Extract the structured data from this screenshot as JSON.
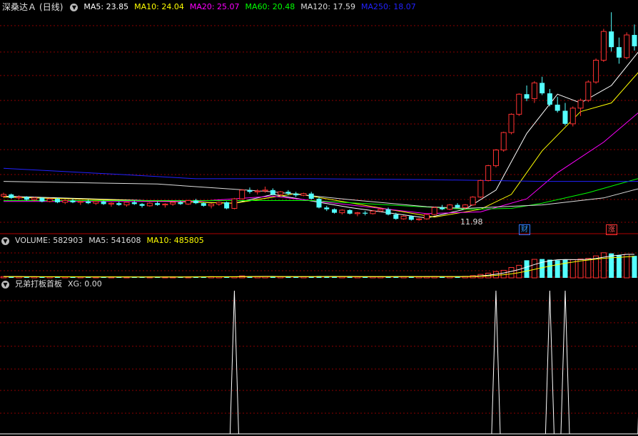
{
  "stock": {
    "name": "深桑达Ａ",
    "period": "(日线)"
  },
  "ma_legend": [
    {
      "label": "MA5: 23.85",
      "color": "#ffffff"
    },
    {
      "label": "MA10: 24.04",
      "color": "#ffff00"
    },
    {
      "label": "MA20: 25.07",
      "color": "#ff00ff"
    },
    {
      "label": "MA60: 20.48",
      "color": "#00ff00"
    },
    {
      "label": "MA120: 17.59",
      "color": "#dddddd"
    },
    {
      "label": "MA250: 18.07",
      "color": "#2222ff"
    }
  ],
  "volume_legend": [
    {
      "label": "VOLUME: 582903",
      "color": "#dddddd"
    },
    {
      "label": "MA5: 541608",
      "color": "#dddddd"
    },
    {
      "label": "MA10: 485805",
      "color": "#ffff00"
    }
  ],
  "indicator_legend": [
    {
      "label": "兄弟打板首板",
      "color": "#dddddd"
    },
    {
      "label": "XG: 0.00",
      "color": "#dddddd"
    }
  ],
  "markers": {
    "low_price": "11.98",
    "finance": "财",
    "limit": "涨"
  },
  "colors": {
    "up": "#ff3232",
    "down": "#54ffff",
    "grid": "#8b0000",
    "divider": "#b00000"
  },
  "chart_data": {
    "type": "candlestick",
    "price_range": [
      10.5,
      36.0
    ],
    "candles": [
      [
        14.8,
        15.2,
        14.6,
        15.0
      ],
      [
        15.0,
        15.1,
        14.5,
        14.6
      ],
      [
        14.6,
        14.9,
        14.4,
        14.7
      ],
      [
        14.7,
        14.8,
        14.3,
        14.4
      ],
      [
        14.4,
        14.7,
        14.2,
        14.6
      ],
      [
        14.6,
        14.7,
        14.1,
        14.2
      ],
      [
        14.2,
        14.6,
        14.1,
        14.5
      ],
      [
        14.5,
        14.6,
        14.0,
        14.1
      ],
      [
        14.1,
        14.4,
        13.9,
        14.3
      ],
      [
        14.3,
        14.5,
        14.0,
        14.1
      ],
      [
        14.1,
        14.3,
        13.8,
        14.2
      ],
      [
        14.2,
        14.4,
        13.9,
        14.0
      ],
      [
        14.0,
        14.3,
        13.8,
        14.2
      ],
      [
        14.2,
        14.3,
        13.8,
        13.9
      ],
      [
        13.9,
        14.1,
        13.6,
        14.0
      ],
      [
        14.0,
        14.2,
        13.7,
        13.8
      ],
      [
        13.8,
        14.2,
        13.6,
        14.1
      ],
      [
        14.1,
        14.3,
        13.8,
        13.9
      ],
      [
        13.9,
        14.0,
        13.5,
        13.7
      ],
      [
        13.7,
        14.1,
        13.6,
        14.0
      ],
      [
        14.0,
        14.2,
        13.7,
        13.8
      ],
      [
        13.8,
        14.0,
        13.5,
        13.9
      ],
      [
        13.9,
        14.2,
        13.7,
        14.1
      ],
      [
        14.1,
        14.3,
        13.8,
        13.9
      ],
      [
        13.9,
        14.4,
        13.8,
        14.3
      ],
      [
        14.3,
        14.5,
        13.9,
        14.0
      ],
      [
        14.0,
        14.1,
        13.6,
        13.7
      ],
      [
        13.7,
        14.0,
        13.4,
        13.9
      ],
      [
        13.9,
        14.2,
        13.7,
        14.1
      ],
      [
        14.1,
        14.2,
        13.3,
        13.4
      ],
      [
        13.4,
        14.6,
        13.3,
        14.5
      ],
      [
        14.5,
        15.6,
        14.4,
        15.5
      ],
      [
        15.5,
        15.8,
        15.1,
        15.3
      ],
      [
        15.3,
        15.6,
        15.0,
        15.4
      ],
      [
        15.4,
        15.9,
        15.2,
        15.5
      ],
      [
        15.5,
        15.7,
        14.9,
        15.0
      ],
      [
        15.0,
        15.4,
        14.8,
        15.3
      ],
      [
        15.3,
        15.5,
        14.9,
        15.1
      ],
      [
        15.1,
        15.3,
        14.7,
        14.9
      ],
      [
        14.9,
        15.2,
        14.8,
        15.1
      ],
      [
        15.1,
        15.3,
        14.4,
        14.5
      ],
      [
        14.5,
        14.7,
        13.4,
        13.5
      ],
      [
        13.5,
        13.7,
        13.1,
        13.3
      ],
      [
        13.3,
        13.4,
        12.8,
        12.9
      ],
      [
        12.9,
        13.3,
        12.7,
        13.2
      ],
      [
        13.2,
        13.3,
        12.7,
        12.8
      ],
      [
        12.8,
        13.0,
        12.5,
        12.9
      ],
      [
        12.9,
        13.1,
        12.6,
        12.8
      ],
      [
        12.8,
        13.2,
        12.7,
        13.1
      ],
      [
        13.1,
        13.4,
        13.0,
        13.3
      ],
      [
        13.3,
        13.5,
        12.6,
        12.7
      ],
      [
        12.7,
        12.9,
        12.1,
        12.2
      ],
      [
        12.2,
        12.6,
        12.1,
        12.5
      ],
      [
        12.5,
        12.6,
        12.0,
        12.1
      ],
      [
        12.1,
        12.3,
        11.98,
        12.2
      ],
      [
        12.2,
        12.8,
        12.1,
        12.7
      ],
      [
        12.7,
        13.6,
        12.6,
        13.5
      ],
      [
        13.5,
        13.8,
        13.2,
        13.3
      ],
      [
        13.3,
        13.9,
        13.2,
        13.8
      ],
      [
        13.8,
        14.0,
        13.4,
        13.5
      ],
      [
        13.5,
        13.9,
        13.3,
        13.8
      ],
      [
        13.8,
        14.8,
        13.7,
        14.7
      ],
      [
        14.7,
        16.7,
        14.6,
        16.6
      ],
      [
        16.6,
        18.4,
        16.5,
        18.3
      ],
      [
        18.3,
        20.2,
        18.1,
        20.1
      ],
      [
        20.1,
        22.2,
        19.9,
        22.1
      ],
      [
        22.1,
        24.3,
        21.9,
        24.2
      ],
      [
        24.2,
        26.6,
        24.0,
        26.5
      ],
      [
        26.5,
        27.5,
        25.7,
        26.0
      ],
      [
        26.0,
        28.0,
        25.5,
        27.8
      ],
      [
        27.8,
        28.5,
        26.4,
        26.6
      ],
      [
        26.6,
        27.1,
        25.1,
        25.3
      ],
      [
        25.3,
        26.2,
        24.4,
        24.6
      ],
      [
        24.6,
        25.5,
        22.9,
        23.1
      ],
      [
        23.1,
        25.1,
        22.8,
        24.9
      ],
      [
        24.9,
        26.0,
        24.0,
        25.8
      ],
      [
        25.8,
        28.1,
        25.6,
        27.9
      ],
      [
        27.9,
        30.6,
        27.7,
        30.4
      ],
      [
        30.4,
        34.0,
        30.2,
        33.7
      ],
      [
        33.7,
        35.9,
        31.4,
        31.9
      ],
      [
        31.9,
        33.0,
        30.0,
        30.7
      ],
      [
        30.7,
        33.6,
        30.5,
        33.3
      ],
      [
        33.3,
        34.5,
        31.5,
        32.0
      ]
    ],
    "ma_lines": [
      {
        "name": "MA5",
        "color": "#ffffff",
        "values": [
          [
            0,
            14.8
          ],
          [
            30,
            14.0
          ],
          [
            35,
            15.0
          ],
          [
            45,
            13.5
          ],
          [
            55,
            12.3
          ],
          [
            60,
            13.3
          ],
          [
            64,
            15.5
          ],
          [
            68,
            22.0
          ],
          [
            72,
            26.5
          ],
          [
            75,
            25.5
          ],
          [
            79,
            27.5
          ],
          [
            84,
            33.0
          ]
        ]
      },
      {
        "name": "MA10",
        "color": "#ffff00",
        "values": [
          [
            0,
            14.7
          ],
          [
            30,
            14.0
          ],
          [
            38,
            15.1
          ],
          [
            50,
            13.3
          ],
          [
            56,
            12.4
          ],
          [
            62,
            13.3
          ],
          [
            66,
            15.0
          ],
          [
            70,
            20.0
          ],
          [
            75,
            24.5
          ],
          [
            79,
            25.5
          ],
          [
            84,
            30.5
          ]
        ]
      },
      {
        "name": "MA20",
        "color": "#ff00ff",
        "values": [
          [
            0,
            14.2
          ],
          [
            25,
            14.2
          ],
          [
            35,
            14.8
          ],
          [
            45,
            13.8
          ],
          [
            55,
            12.8
          ],
          [
            62,
            13.0
          ],
          [
            68,
            14.5
          ],
          [
            72,
            17.5
          ],
          [
            78,
            21.0
          ],
          [
            84,
            25.5
          ]
        ]
      },
      {
        "name": "MA60",
        "color": "#00ff00",
        "values": [
          [
            0,
            14.3
          ],
          [
            40,
            14.3
          ],
          [
            50,
            13.8
          ],
          [
            60,
            13.3
          ],
          [
            66,
            13.4
          ],
          [
            70,
            14.0
          ],
          [
            76,
            15.2
          ],
          [
            84,
            17.2
          ]
        ]
      },
      {
        "name": "MA120",
        "color": "#dddddd",
        "values": [
          [
            0,
            16.5
          ],
          [
            20,
            16.2
          ],
          [
            35,
            15.3
          ],
          [
            45,
            14.4
          ],
          [
            55,
            13.6
          ],
          [
            60,
            13.4
          ],
          [
            70,
            13.8
          ],
          [
            78,
            14.6
          ],
          [
            84,
            16.0
          ]
        ]
      },
      {
        "name": "MA250",
        "color": "#2222ff",
        "values": [
          [
            0,
            18.0
          ],
          [
            15,
            17.3
          ],
          [
            25,
            16.8
          ],
          [
            40,
            16.8
          ],
          [
            55,
            16.7
          ],
          [
            70,
            16.5
          ],
          [
            84,
            16.5
          ]
        ]
      }
    ],
    "volume_scale": 1000000,
    "volume": [
      40000,
      38000,
      35000,
      34000,
      36000,
      33000,
      32000,
      34000,
      31000,
      30000,
      32000,
      31000,
      30000,
      29000,
      31000,
      30000,
      29000,
      32000,
      30000,
      31000,
      30000,
      29000,
      31000,
      30000,
      32000,
      35000,
      45000,
      38000,
      33000,
      34000,
      35000,
      62000,
      45000,
      40000,
      42000,
      38000,
      36000,
      35000,
      34000,
      36000,
      38000,
      55000,
      48000,
      40000,
      38000,
      36000,
      35000,
      34000,
      37000,
      38000,
      39000,
      42000,
      40000,
      38000,
      36000,
      38000,
      45000,
      40000,
      42000,
      44000,
      48000,
      70000,
      110000,
      150000,
      200000,
      240000,
      330000,
      400000,
      560000,
      590000,
      600000,
      580000,
      560000,
      590000,
      580000,
      600000,
      620000,
      700000,
      800000,
      780000,
      720000,
      750000,
      700000
    ],
    "xg_signals": [
      30,
      64,
      71,
      73,
      83
    ]
  }
}
